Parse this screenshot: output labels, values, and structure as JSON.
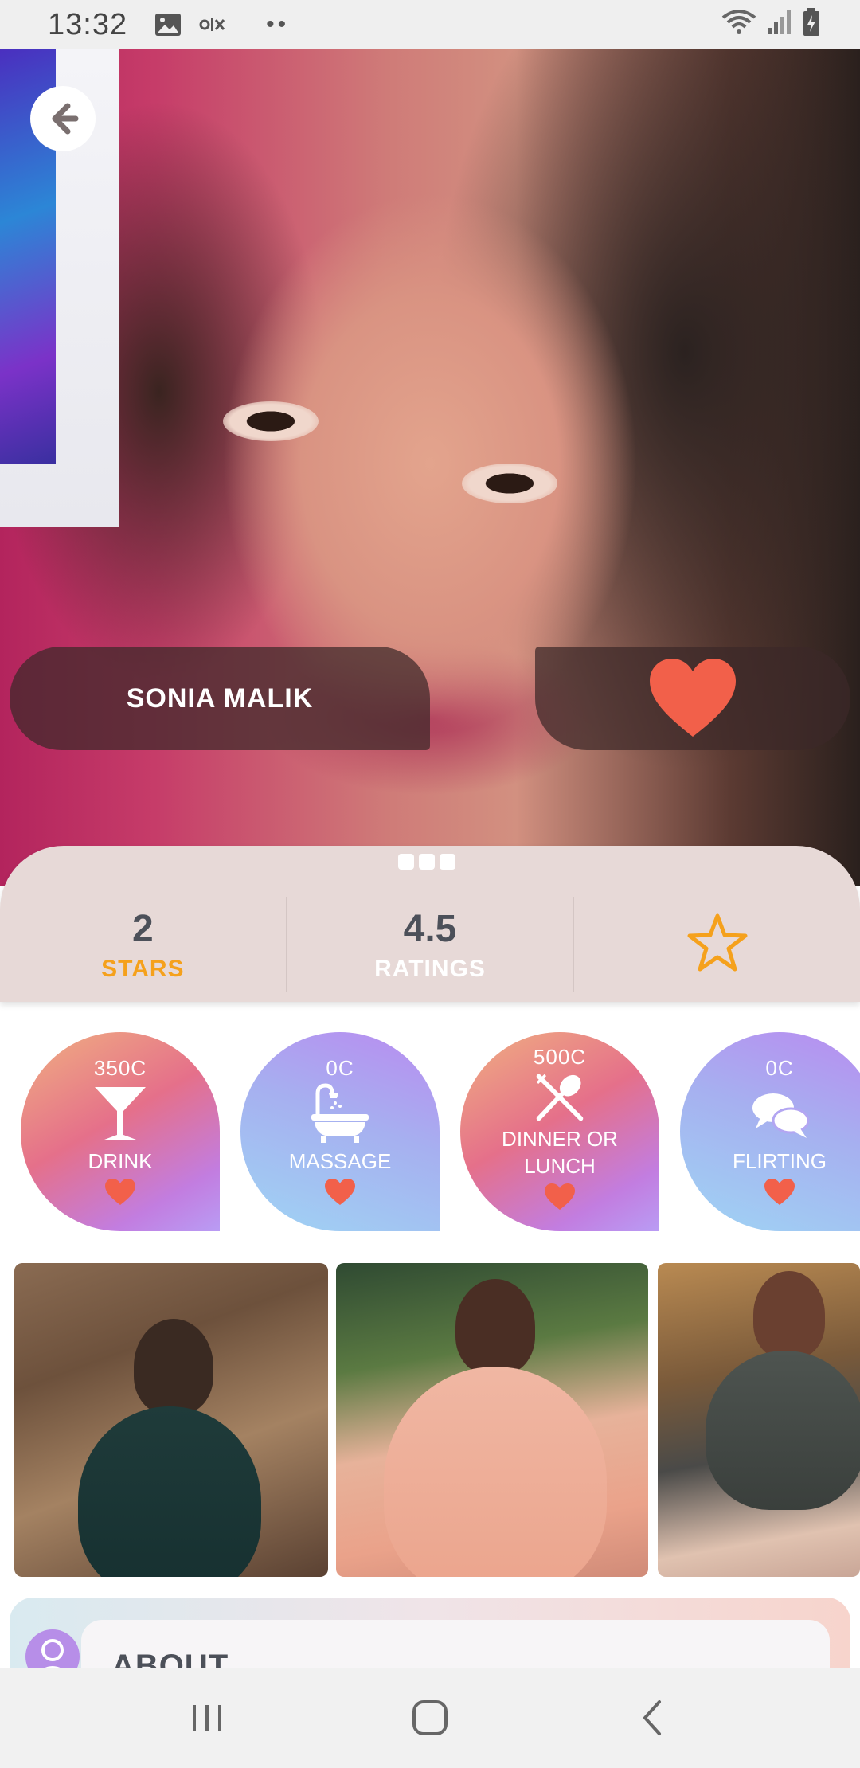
{
  "status_bar": {
    "time": "13:32",
    "dots": "••",
    "icons": [
      "image-icon",
      "olx-icon",
      "wifi-icon",
      "signal-icon",
      "battery-icon"
    ]
  },
  "profile": {
    "name": "SONIA MALIK",
    "favorite_icon": "heart-icon",
    "back_icon": "arrow-left-icon"
  },
  "stats": {
    "stars_value": "2",
    "stars_label": "STARS",
    "ratings_value": "4.5",
    "ratings_label": "RATINGS",
    "rate_icon": "star-outline-icon",
    "page_indicator_count": 3
  },
  "services": [
    {
      "price": "350C",
      "label": "DRINK",
      "icon": "cocktail-icon",
      "style": "warm"
    },
    {
      "price": "0C",
      "label": "MASSAGE",
      "icon": "bathtub-icon",
      "style": "cool"
    },
    {
      "price": "500C",
      "label": "DINNER OR LUNCH",
      "icon": "utensils-icon",
      "style": "warm"
    },
    {
      "price": "0C",
      "label": "FLIRTING",
      "icon": "chat-bubbles-icon",
      "style": "cool"
    }
  ],
  "gallery": {
    "photos": [
      "photo-1",
      "photo-2",
      "photo-3"
    ]
  },
  "about": {
    "title": "ABOUT"
  },
  "colors": {
    "accent_orange": "#f5a11c",
    "heart_red": "#f2604a",
    "stats_bg": "#e7d9d7",
    "text_dark": "#4c5059"
  },
  "nav_bar": {
    "icons": [
      "recent-apps-icon",
      "home-icon",
      "back-icon"
    ]
  }
}
